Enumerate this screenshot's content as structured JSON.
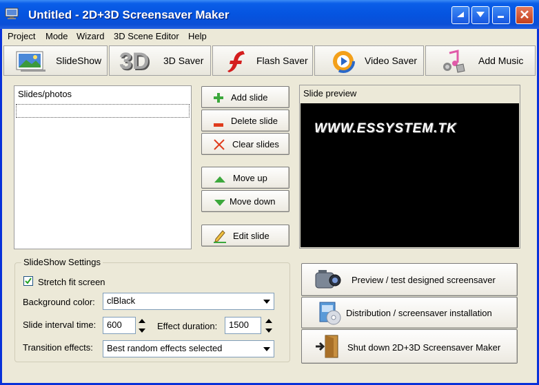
{
  "window": {
    "title": "Untitled - 2D+3D Screensaver Maker"
  },
  "menu": [
    "Project",
    "Mode",
    "Wizard",
    "3D Scene Editor",
    "Help"
  ],
  "toolbar": {
    "slideshow": "SlideShow",
    "saver3d": "3D Saver",
    "saver3d_big": "3D",
    "flash": "Flash Saver",
    "video": "Video Saver",
    "music": "Add Music"
  },
  "slides": {
    "label": "Slides/photos"
  },
  "buttons": {
    "add": "Add slide",
    "delete": "Delete slide",
    "clear": "Clear slides",
    "move_up": "Move up",
    "move_down": "Move down",
    "edit": "Edit slide"
  },
  "preview": {
    "label": "Slide preview",
    "text": "WWW.ESSYSTEM.TK"
  },
  "settings": {
    "title": "SlideShow Settings",
    "stretch_label": "Stretch fit screen",
    "stretch_checked": true,
    "bg_label": "Background color:",
    "bg_value": "clBlack",
    "interval_label": "Slide interval time:",
    "interval_value": "600",
    "effect_label": "Effect duration:",
    "effect_value": "1500",
    "transition_label": "Transition effects:",
    "transition_value": "Best random effects selected"
  },
  "actions": {
    "preview": "Preview / test designed screensaver",
    "distribution": "Distribution / screensaver installation",
    "shutdown": "Shut down 2D+3D Screensaver Maker"
  },
  "colors": {
    "titlebar": "#0554e0",
    "face": "#ece9d8",
    "accent_green": "#3ca83c",
    "accent_red": "#e03c1c"
  }
}
